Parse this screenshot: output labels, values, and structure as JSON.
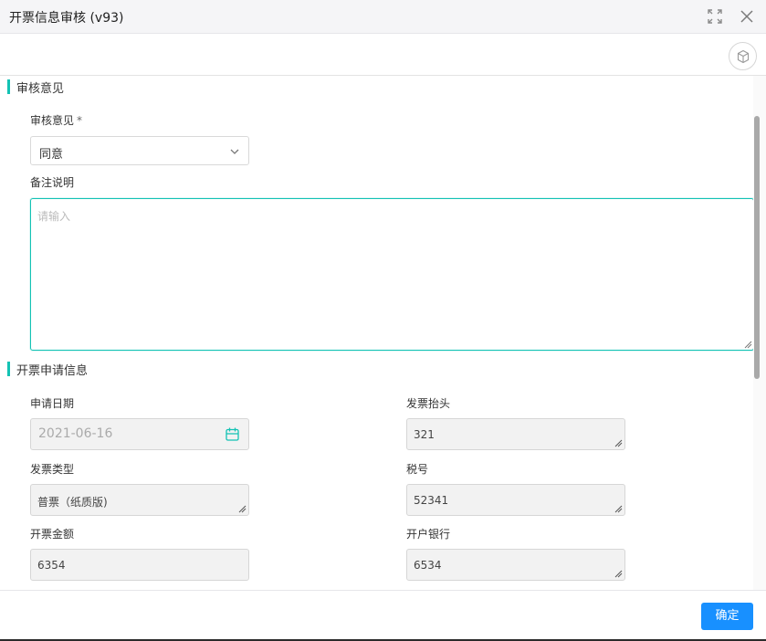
{
  "window": {
    "title": "开票信息审核 (v93)",
    "maximize_icon": "maximize-icon",
    "close_icon": "close-icon"
  },
  "toolbar": {
    "cube_icon": "cube-icon"
  },
  "review_section": {
    "title": "审核意见",
    "opinion_label": "审核意见",
    "required_mark": "*",
    "opinion_value": "同意",
    "remarks_label": "备注说明",
    "remarks_placeholder": "请输入",
    "remarks_value": ""
  },
  "invoice_section": {
    "title": "开票申请信息",
    "apply_date_label": "申请日期",
    "apply_date_value": "2021-06-16",
    "invoice_header_label": "发票抬头",
    "invoice_header_value": "321",
    "invoice_type_label": "发票类型",
    "invoice_type_value": "普票（纸质版)",
    "tax_no_label": "税号",
    "tax_no_value": "52341",
    "amount_label": "开票金额",
    "amount_value": "6354",
    "bank_label": "开户银行",
    "bank_value": "6534"
  },
  "footer": {
    "confirm_label": "确定"
  },
  "colors": {
    "accent": "#13c2b4",
    "primary": "#1890ff",
    "readonly_bg": "#f2f2f2"
  }
}
